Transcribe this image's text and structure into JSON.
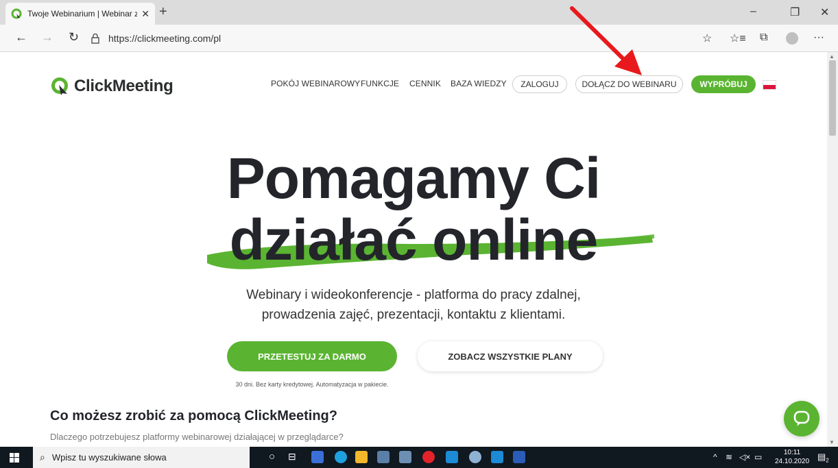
{
  "browser": {
    "tab_title": "Twoje Webinarium | Webinar z P",
    "tab_close": "✕",
    "new_tab": "+",
    "url": "https://clickmeeting.com/pl",
    "back": "←",
    "forward": "→",
    "refresh": "↻",
    "window_minimize": "–",
    "window_restore": "❐",
    "window_close": "✕",
    "favorite_icon": "☆",
    "favorites_list_icon": "☆≡",
    "collections_icon": "⧉",
    "more_icon": "···"
  },
  "header": {
    "logo_text": "ClickMeeting",
    "nav": [
      "POKÓJ WEBINAROWY",
      "FUNKCJE",
      "CENNIK",
      "BAZA WIEDZY"
    ],
    "login": "ZALOGUJ",
    "join": "DOŁĄCZ DO WEBINARU",
    "try": "WYPRÓBUJ"
  },
  "hero": {
    "line1": "Pomagamy Ci",
    "line2": "działać online",
    "sub1": "Webinary i wideokonferencje - platforma do pracy zdalnej,",
    "sub2": "prowadzenia zajęć, prezentacji, kontaktu z klientami.",
    "cta_primary": "PRZETESTUJ ZA DARMO",
    "cta_secondary": "ZOBACZ WSZYSTKIE PLANY",
    "note": "30 dni. Bez karty kredytowej. Automatyzacja w pakiecie."
  },
  "section": {
    "title": "Co możesz zrobić za pomocą ClickMeeting?",
    "subtitle": "Dlaczego potrzebujesz platformy webinarowej działającej w przeglądarce?"
  },
  "taskbar": {
    "search_placeholder": "Wpisz tu wyszukiwane słowa",
    "time": "10:11",
    "date": "24.10.2020",
    "notifications": "2"
  },
  "colors": {
    "brand_green": "#5ab431",
    "arrow_red": "#e8191c",
    "heading_dark": "#23252b"
  }
}
